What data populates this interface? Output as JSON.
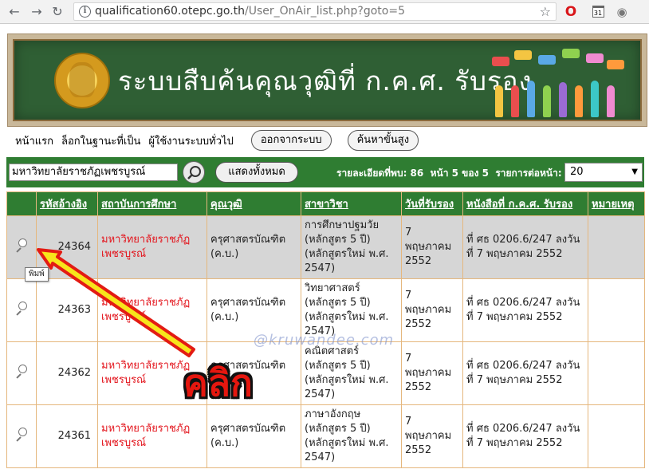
{
  "browser": {
    "url_host": "qualification60.otepc.go.th",
    "url_path": "/User_OnAir_list.php?goto=5",
    "calendar_day": "31"
  },
  "banner": {
    "title": "ระบบสืบค้นคุณวุฒิที่ ก.ค.ศ. รับรอง"
  },
  "topnav": {
    "home": "หน้าแรก",
    "login_as": "ล็อกในฐานะที่เป็น",
    "user_role": "ผู้ใช้งานระบบทั่วไป",
    "logout_button": "ออกจากระบบ",
    "advanced_search_button": "ค้นหาขั้นสูง"
  },
  "search": {
    "value": "มหาวิทยาลัยราชภัฏเพชรบูรณ์",
    "show_all_button": "แสดงทั้งหมด",
    "details_found": "รายละเอียดที่พบ: 86",
    "page_info": "หน้า 5 ของ 5",
    "per_page_label": "รายการต่อหน้า:",
    "per_page_value": "20"
  },
  "table": {
    "headers": [
      "",
      "รหัสอ้างอิง",
      "สถาบันการศึกษา",
      "คุณวุฒิ",
      "สาขาวิชา",
      "วันที่รับรอง",
      "หนังสือที่ ก.ค.ศ. รับรอง",
      "หมายเหตุ"
    ],
    "rows": [
      {
        "id": "24364",
        "institution": "มหาวิทยาลัยราชภัฏเพชรบูรณ์",
        "degree": "ครุศาสตรบัณฑิต (ค.บ.)",
        "major": "การศึกษาปฐมวัย (หลักสูตร 5 ปี) (หลักสูตรใหม่ พ.ศ. 2547)",
        "date": "7 พฤษภาคม 2552",
        "letter": "ที่ ศธ 0206.6/247 ลงวันที่ 7 พฤษภาคม 2552",
        "note": ""
      },
      {
        "id": "24363",
        "institution": "มหาวิทยาลัยราชภัฏเพชรบูรณ์",
        "degree": "ครุศาสตรบัณฑิต (ค.บ.)",
        "major": "วิทยาศาสตร์ (หลักสูตร 5 ปี) (หลักสูตรใหม่ พ.ศ. 2547)",
        "date": "7 พฤษภาคม 2552",
        "letter": "ที่ ศธ 0206.6/247 ลงวันที่ 7 พฤษภาคม 2552",
        "note": ""
      },
      {
        "id": "24362",
        "institution": "มหาวิทยาลัยราชภัฏเพชรบูรณ์",
        "degree": "ครุศาสตรบัณฑิต (ค.บ.)",
        "major": "คณิตศาสตร์ (หลักสูตร 5 ปี) (หลักสูตรใหม่ พ.ศ. 2547)",
        "date": "7 พฤษภาคม 2552",
        "letter": "ที่ ศธ 0206.6/247 ลงวันที่ 7 พฤษภาคม 2552",
        "note": ""
      },
      {
        "id": "24361",
        "institution": "มหาวิทยาลัยราชภัฏเพชรบูรณ์",
        "degree": "ครุศาสตรบัณฑิต (ค.บ.)",
        "major": "ภาษาอังกฤษ (หลักสูตร 5 ปี) (หลักสูตรใหม่ พ.ศ. 2547)",
        "date": "7 พฤษภาคม 2552",
        "letter": "ที่ ศธ 0206.6/247 ลงวันที่ 7 พฤษภาคม 2552",
        "note": ""
      }
    ]
  },
  "tooltip": "พิมพ์",
  "watermark": "@kruwandee.com",
  "annotation": {
    "label": "คลิก",
    "color": "#e5170f"
  },
  "colors": {
    "header_green": "#2f7d32",
    "institution_red": "#e3141c",
    "border_tan": "#e5b77d"
  }
}
